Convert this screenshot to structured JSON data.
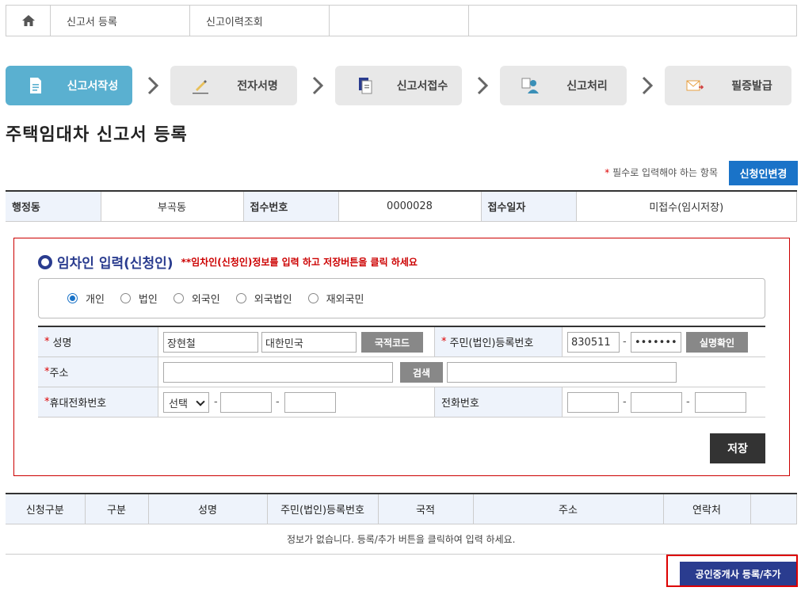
{
  "topnav": {
    "home_icon": "home-icon",
    "tabs": [
      "신고서 등록",
      "신고이력조회",
      ""
    ]
  },
  "steps": [
    {
      "label": "신고서작성",
      "icon": "document-icon",
      "active": true
    },
    {
      "label": "전자서명",
      "icon": "pen-sign-icon",
      "active": false
    },
    {
      "label": "신고서접수",
      "icon": "file-stack-icon",
      "active": false
    },
    {
      "label": "신고처리",
      "icon": "person-desk-icon",
      "active": false
    },
    {
      "label": "필증발급",
      "icon": "certificate-icon",
      "active": false
    }
  ],
  "page_title": "주택임대차 신고서 등록",
  "required_note": {
    "star": "*",
    "text": " 필수로 입력해야 하는 항목"
  },
  "change_applicant_label": "신청인변경",
  "info": {
    "admin_dong_label": "행정동",
    "admin_dong_value": "부곡동",
    "receipt_no_label": "접수번호",
    "receipt_no_value": "0000028",
    "receipt_date_label": "접수일자",
    "receipt_date_value": "미접수(임시저장)"
  },
  "tenant_section": {
    "title": "임차인 입력(신청인)",
    "hint": "**임차인(신청인)정보를 입력 하고 저장버튼을 클릭 하세요",
    "person_types": [
      "개인",
      "법인",
      "외국인",
      "외국법인",
      "재외국민"
    ],
    "selected_type": "개인",
    "name_label": "성명",
    "name_value": "장현철",
    "nationality_value": "대한민국",
    "nationality_code_button": "국적코드",
    "resident_no_label": "주민(법인)등록번호",
    "resident_no_front": "830511",
    "resident_no_back": "•••••••",
    "verify_button": "실명확인",
    "address_label": "주소",
    "address_value": "",
    "address_detail_value": "",
    "search_button": "검색",
    "mobile_label": "휴대전화번호",
    "mobile_select": "선택",
    "phone_label": "전화번호",
    "dash": "-",
    "required_star": "*",
    "save_button": "저장"
  },
  "result_table": {
    "headers": [
      "신청구분",
      "구분",
      "성명",
      "주민(법인)등록번호",
      "국적",
      "주소",
      "연락처",
      ""
    ],
    "empty_message": "정보가 없습니다.   등록/추가 버튼을 클릭하여 입력 하세요."
  },
  "broker_button": "공인중개사 등록/추가",
  "colors": {
    "active_step": "#5ab0d0",
    "primary_blue": "#1a73c8",
    "navy": "#2a3c8f",
    "required_red": "#dd0000",
    "header_bg": "#eef3fb"
  }
}
